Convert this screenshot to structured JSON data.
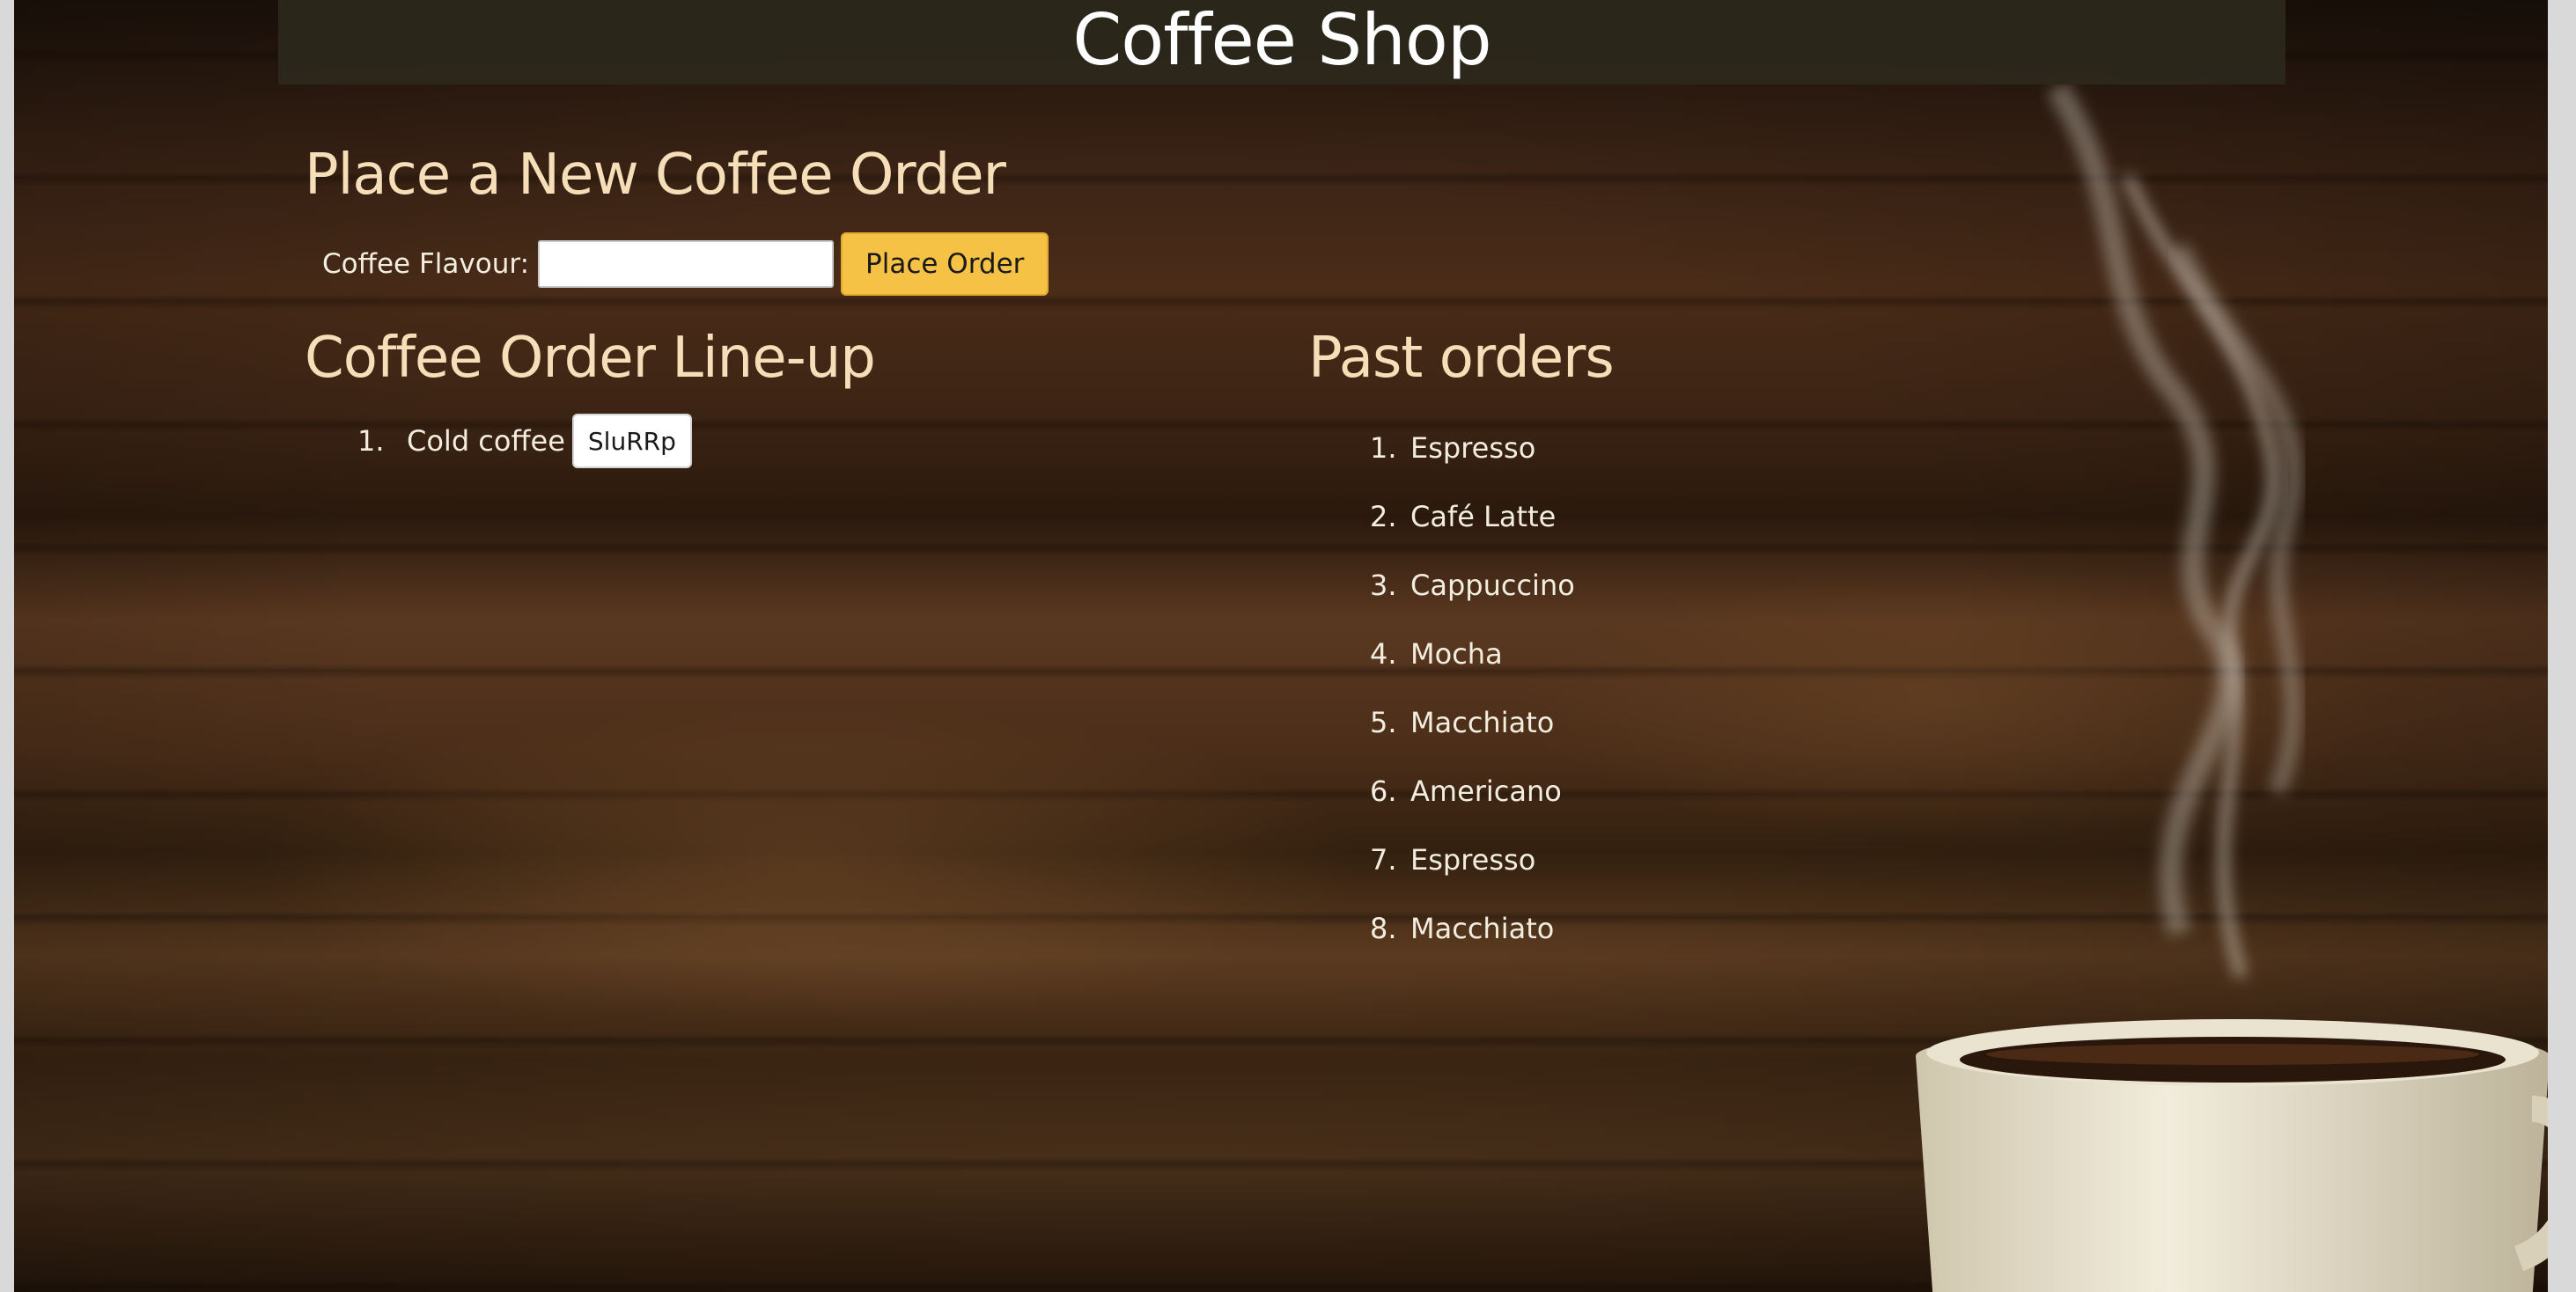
{
  "header": {
    "title": "Coffee Shop"
  },
  "new_order": {
    "title": "Place a New Coffee Order",
    "field_label": "Coffee Flavour:",
    "field_value": "",
    "submit_label": "Place Order"
  },
  "lineup": {
    "title": "Coffee Order Line-up",
    "items": [
      {
        "number": "1.",
        "label": "Cold coffee",
        "action_label": "SluRRp"
      }
    ]
  },
  "past_orders": {
    "title": "Past orders",
    "items": [
      {
        "number": "1.",
        "label": "Espresso"
      },
      {
        "number": "2.",
        "label": "Café Latte"
      },
      {
        "number": "3.",
        "label": "Cappuccino"
      },
      {
        "number": "4.",
        "label": "Mocha"
      },
      {
        "number": "5.",
        "label": "Macchiato"
      },
      {
        "number": "6.",
        "label": "Americano"
      },
      {
        "number": "7.",
        "label": "Espresso"
      },
      {
        "number": "8.",
        "label": "Macchiato"
      }
    ]
  },
  "colors": {
    "header_bg": "#2c281c",
    "heading_text": "#f6dfb8",
    "primary_button": "#f6c246",
    "body_text": "#f3ede0"
  },
  "decorations": {
    "background_image": "wood-table-texture",
    "cup_image": "steaming-coffee-cup"
  }
}
